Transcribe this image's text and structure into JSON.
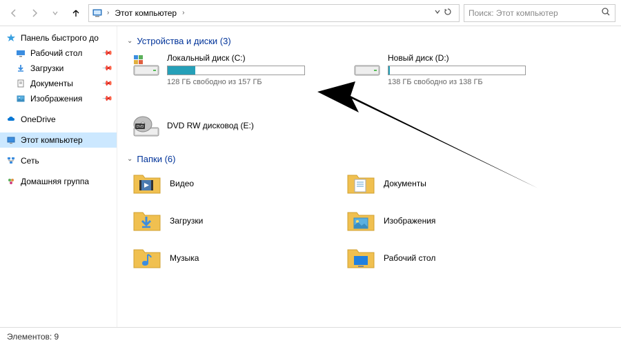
{
  "toolbar": {
    "breadcrumb": "Этот компьютер",
    "search_placeholder": "Поиск: Этот компьютер"
  },
  "sidebar": {
    "quick_access": "Панель быстрого до",
    "items": [
      {
        "label": "Рабочий стол",
        "pinned": true
      },
      {
        "label": "Загрузки",
        "pinned": true
      },
      {
        "label": "Документы",
        "pinned": true
      },
      {
        "label": "Изображения",
        "pinned": true
      }
    ],
    "onedrive": "OneDrive",
    "this_pc": "Этот компьютер",
    "network": "Сеть",
    "homegroup": "Домашняя группа"
  },
  "main": {
    "devices_header": "Устройства и диски (3)",
    "drives": [
      {
        "name": "Локальный диск (C:)",
        "free": "128 ГБ свободно из 157 ГБ",
        "fill_pct": 20
      },
      {
        "name": "Новый диск (D:)",
        "free": "138 ГБ свободно из 138 ГБ",
        "fill_pct": 1
      },
      {
        "name": "DVD RW дисковод (E:)"
      }
    ],
    "folders_header": "Папки (6)",
    "folders": [
      {
        "name": "Видео"
      },
      {
        "name": "Документы"
      },
      {
        "name": "Загрузки"
      },
      {
        "name": "Изображения"
      },
      {
        "name": "Музыка"
      },
      {
        "name": "Рабочий стол"
      }
    ]
  },
  "statusbar": {
    "text": "Элементов: 9"
  }
}
